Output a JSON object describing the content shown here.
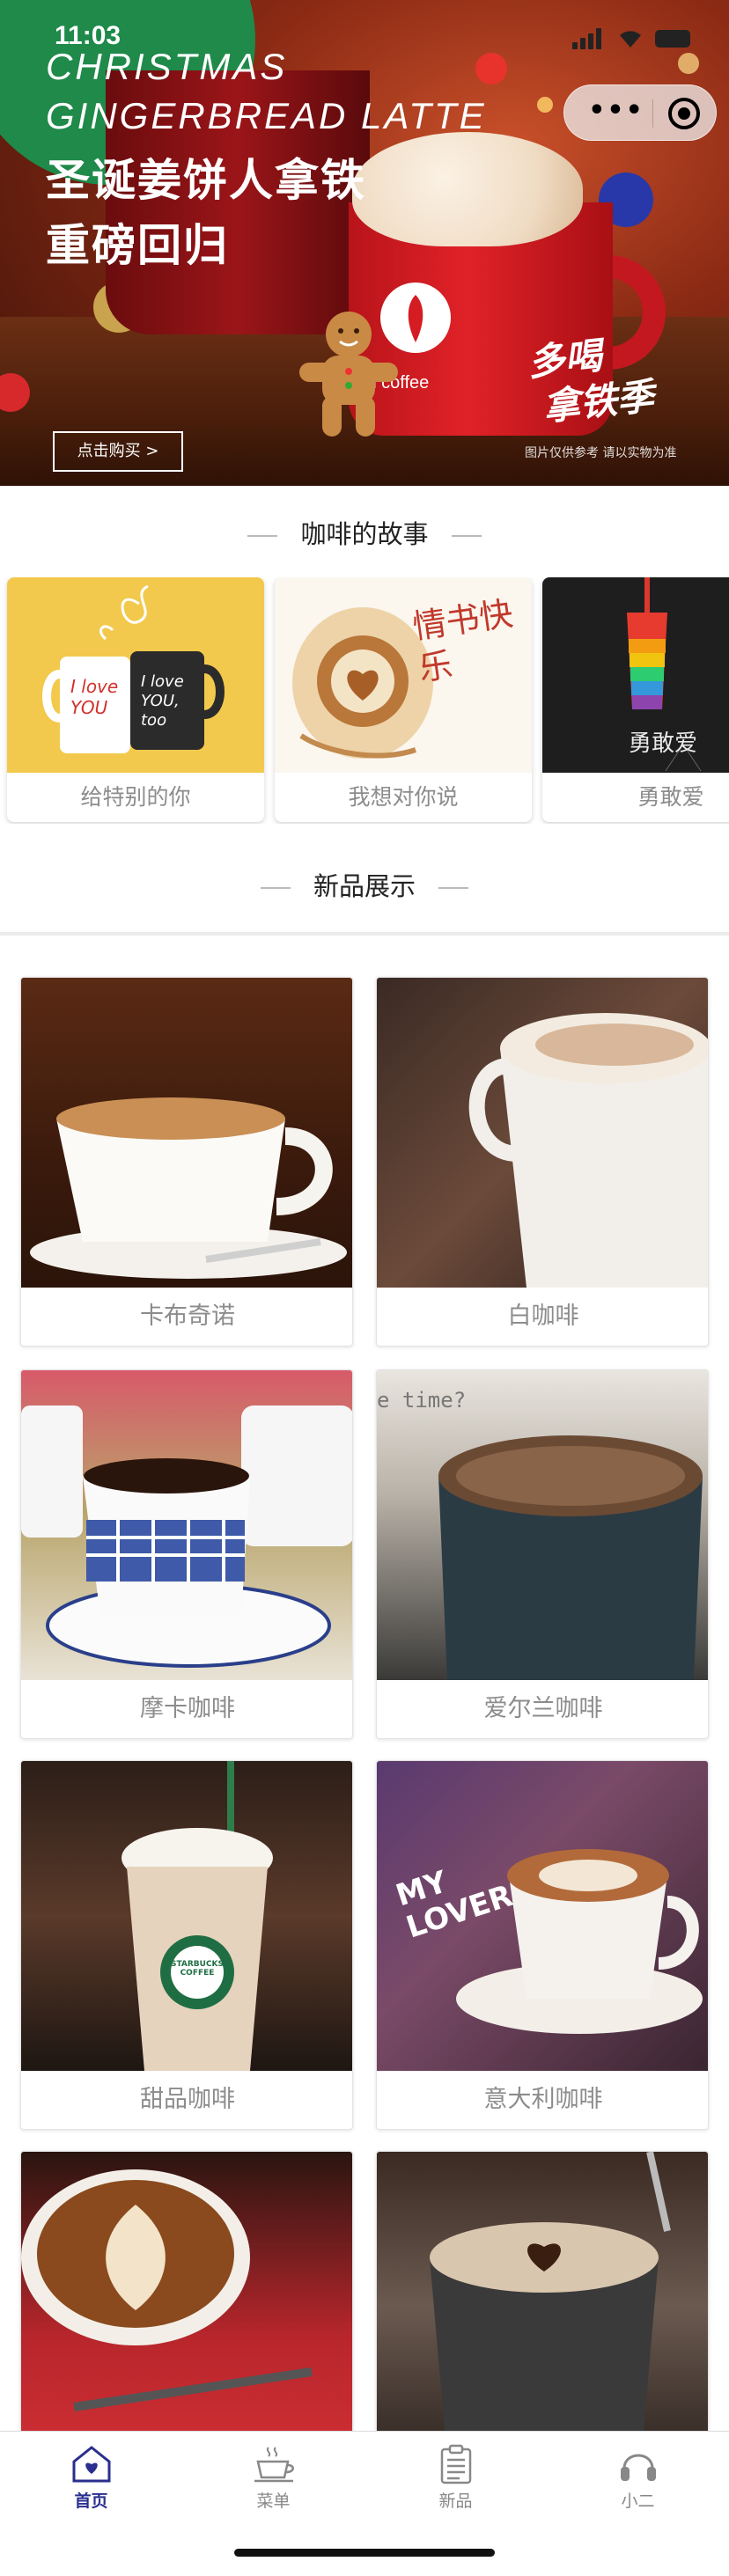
{
  "status_bar": {
    "time": "11:03"
  },
  "banner": {
    "title_en_line1": "CHRISTMAS",
    "title_en_line2": "GINGERBREAD LATTE",
    "title_cn_line1": "圣诞姜饼人拿铁",
    "title_cn_line2": "重磅回归",
    "brand": "in coffee",
    "slogan_line1": "多喝",
    "slogan_line2": "拿铁季",
    "buy_button": "点击购买 >",
    "credit": "图片仅供参考 请以实物为准"
  },
  "capsule": {
    "more_icon": "more-dots-icon",
    "close_icon": "close-circle-icon"
  },
  "stories": {
    "title": "咖啡的故事",
    "items": [
      {
        "label": "给特别的你",
        "image_text_left": "I love YOU",
        "image_text_right": "I love YOU, too"
      },
      {
        "label": "我想对你说",
        "image_text": "情书快乐"
      },
      {
        "label": "勇敢爱",
        "image_text": "勇敢爱"
      }
    ]
  },
  "products": {
    "title": "新品展示",
    "items": [
      {
        "label": "卡布奇诺"
      },
      {
        "label": "白咖啡"
      },
      {
        "label": "摩卡咖啡"
      },
      {
        "label": "爱尔兰咖啡",
        "image_text": "e time?"
      },
      {
        "label": "甜品咖啡",
        "image_text": "STARBUCKS COFFEE"
      },
      {
        "label": "意大利咖啡",
        "image_text": "MY LOVER"
      },
      {
        "label": ""
      },
      {
        "label": ""
      }
    ]
  },
  "tabbar": {
    "items": [
      {
        "label": "首页",
        "icon": "home-heart-icon",
        "active": true
      },
      {
        "label": "菜单",
        "icon": "coffee-cup-icon",
        "active": false
      },
      {
        "label": "新品",
        "icon": "clipboard-icon",
        "active": false
      },
      {
        "label": "小二",
        "icon": "headset-icon",
        "active": false
      }
    ]
  },
  "colors": {
    "accent": "#2a2f8f",
    "label_gray": "#8c8c8c",
    "banner_red": "#e02228"
  }
}
